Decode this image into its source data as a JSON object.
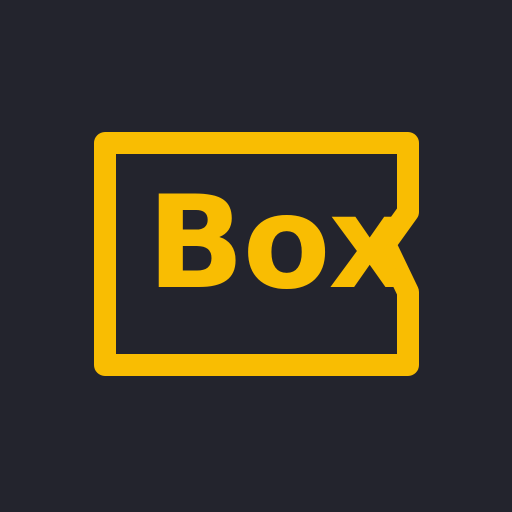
{
  "logo": {
    "wordmark": "Box"
  },
  "colors": {
    "background": "#23242d",
    "accent": "#f9bd02"
  }
}
